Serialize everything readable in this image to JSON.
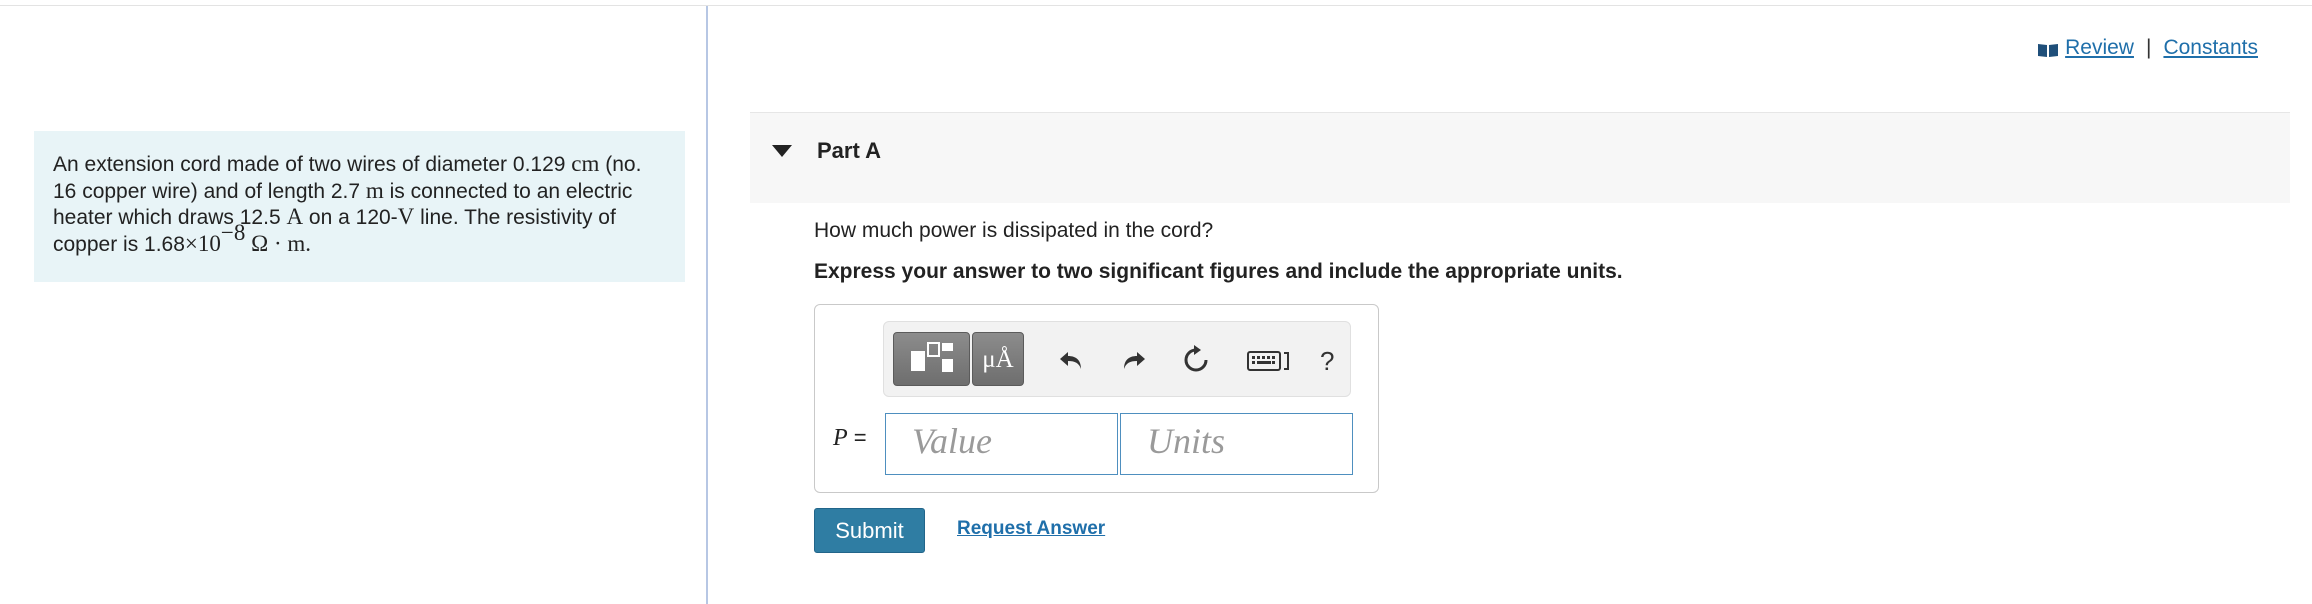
{
  "header": {
    "review_label": "Review",
    "separator": "|",
    "constants_label": "Constants"
  },
  "problem": {
    "line1": "An extension cord made of two wires of diameter 0.129 ",
    "diam_unit": "cm",
    "line1b": " (no.",
    "line2": "16 copper wire) and of length 2.7 ",
    "len_unit": "m",
    "line2b": " is connected to an electric",
    "line3": "heater which draws 12.5 ",
    "amp_unit": "A",
    "line3b": " on a 120-",
    "volt_unit": "V",
    "line3c": " line. The resistivity of",
    "line4": "copper is 1.68",
    "times": "×10",
    "exponent": "−8",
    "res_unit": " Ω · m."
  },
  "part": {
    "title": "Part A",
    "question": "How much power is dissipated in the cord?",
    "instruction": "Express your answer to two significant figures and include the appropriate units."
  },
  "answer": {
    "variable": "P",
    "equals": " =",
    "value_placeholder": "Value",
    "units_placeholder": "Units",
    "units_button": "μÅ",
    "help": "?"
  },
  "actions": {
    "submit": "Submit",
    "request_answer": "Request Answer"
  },
  "colors": {
    "accent": "#2f7da3",
    "link": "#1f6faa",
    "problem_bg": "#e8f4f7"
  }
}
